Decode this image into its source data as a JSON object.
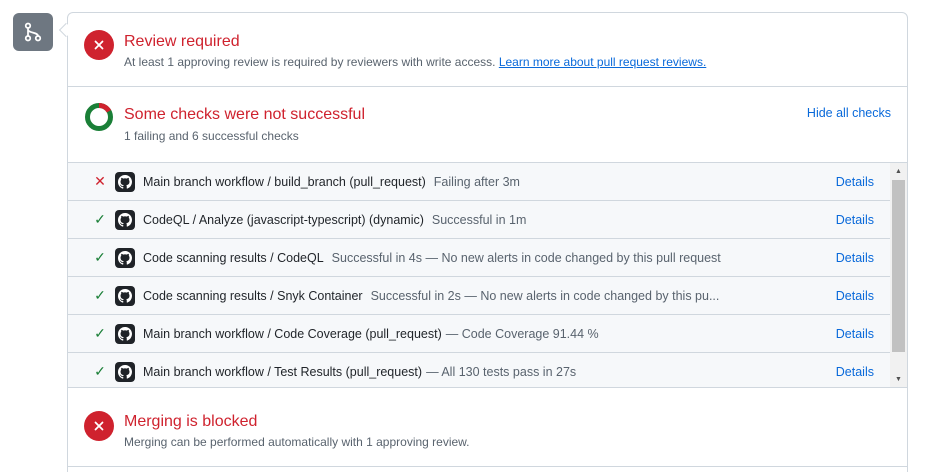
{
  "review": {
    "title": "Review required",
    "subtitle": "At least 1 approving review is required by reviewers with write access.",
    "link": "Learn more about pull request reviews."
  },
  "checks": {
    "title": "Some checks were not successful",
    "subtitle": "1 failing and 6 successful checks",
    "toggle_label": "Hide all checks",
    "details_label": "Details",
    "items": [
      {
        "status": "fail",
        "name": "Main branch workflow / build_branch (pull_request)",
        "desc": "Failing after 3m"
      },
      {
        "status": "success",
        "name": "CodeQL / Analyze (javascript-typescript) (dynamic)",
        "desc": "Successful in 1m"
      },
      {
        "status": "success",
        "name": "Code scanning results / CodeQL",
        "desc": "Successful in 4s — No new alerts in code changed by this pull request"
      },
      {
        "status": "success",
        "name": "Code scanning results / Snyk Container",
        "desc": "Successful in 2s — No new alerts in code changed by this pu..."
      },
      {
        "status": "success",
        "name": "Main branch workflow / Code Coverage (pull_request)",
        "desc": "— Code Coverage 91.44 %"
      },
      {
        "status": "success",
        "name": "Main branch workflow / Test Results (pull_request)",
        "desc": "— All 130 tests pass in 27s"
      }
    ]
  },
  "merge": {
    "title": "Merging is blocked",
    "subtitle": "Merging can be performed automatically with 1 approving review."
  },
  "icons": {
    "badge": "git-merge-icon",
    "review_status": "x-circle-icon",
    "checks_status": "donut-progress-icon",
    "fail": "x-icon",
    "success": "check-icon",
    "app": "github-logo-icon"
  },
  "colors": {
    "danger": "#cf222e",
    "success": "#1a7f37",
    "link": "#0969da",
    "muted": "#59636e"
  }
}
